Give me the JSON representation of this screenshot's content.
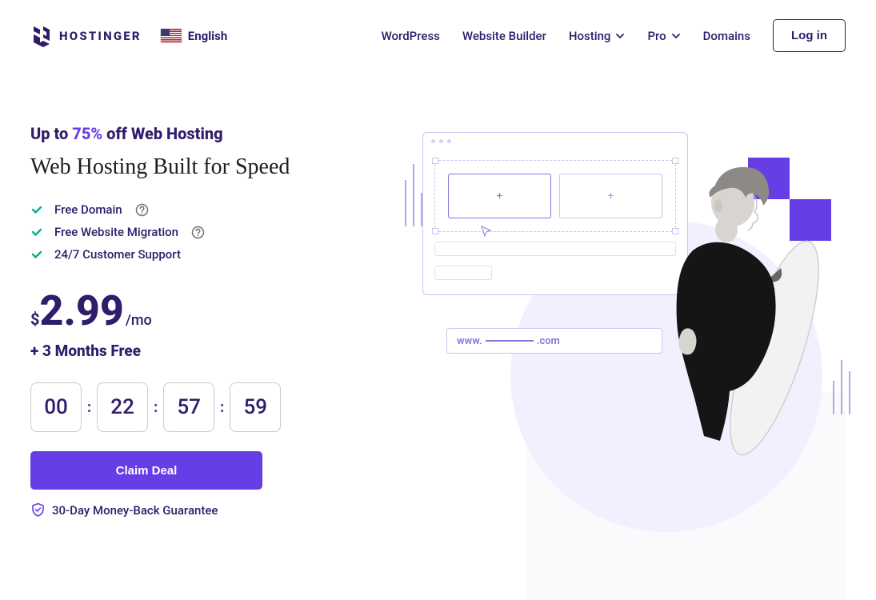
{
  "header": {
    "brand": "HOSTINGER",
    "language": "English",
    "nav": {
      "wordpress": "WordPress",
      "builder": "Website Builder",
      "hosting": "Hosting",
      "pro": "Pro",
      "domains": "Domains"
    },
    "login": "Log in"
  },
  "hero": {
    "discount_prefix": "Up to ",
    "discount_pct": "75%",
    "discount_suffix": " off Web Hosting",
    "headline": "Web Hosting Built for Speed",
    "features": {
      "f1": "Free Domain",
      "f2": "Free Website Migration",
      "f3": "24/7 Customer Support"
    },
    "price": {
      "currency": "$",
      "amount": "2.99",
      "period": "/mo"
    },
    "bonus": "+ 3 Months Free",
    "countdown": {
      "d": "00",
      "h": "22",
      "m": "57",
      "s": "59"
    },
    "cta": "Claim Deal",
    "guarantee": "30-Day Money-Back Guarantee",
    "url_prefix": "www.",
    "url_suffix": ".com"
  }
}
